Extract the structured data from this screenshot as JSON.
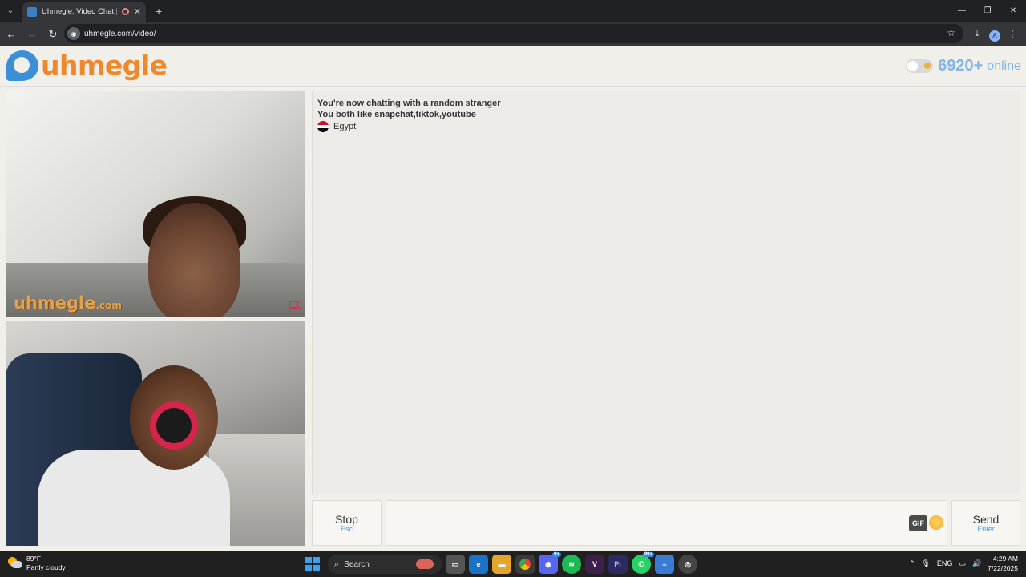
{
  "browser": {
    "tab_title": "Uhmegle: Video Chat | Ome",
    "new_tab": "+",
    "url": "uhmegle.com/video/",
    "profile_initial": "A",
    "window_controls": {
      "minimize": "—",
      "restore": "❐",
      "close": "✕"
    }
  },
  "site": {
    "logo_text": "uhmegle",
    "online_count": "6920+",
    "online_label": "online"
  },
  "video": {
    "watermark_main": "uhmegle",
    "watermark_suffix": ".com"
  },
  "chat": {
    "messages": [
      "You're now chatting with a random stranger",
      "You both like snapchat,tiktok,youtube"
    ],
    "country": "Egypt"
  },
  "controls": {
    "stop_label": "Stop",
    "stop_hint": "Esc",
    "gif_label": "GIF",
    "send_label": "Send",
    "send_hint": "Enter"
  },
  "taskbar": {
    "weather_temp": "89°F",
    "weather_desc": "Partly cloudy",
    "search_placeholder": "Search",
    "discord_badge": "9+",
    "whatsapp_badge": "99+",
    "lang": "ENG",
    "time": "4:29 AM",
    "date": "7/22/2025"
  },
  "colors": {
    "brand_orange": "#f0882b",
    "brand_blue": "#3b8fd6",
    "online_blue": "#80b7e8",
    "hint_blue": "#4a9be0"
  }
}
